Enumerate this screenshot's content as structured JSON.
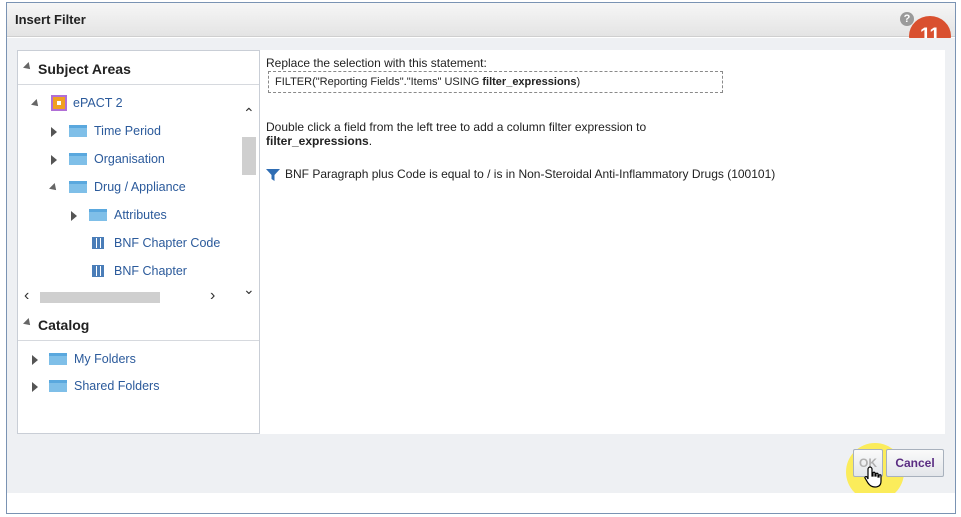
{
  "dialog": {
    "title": "Insert Filter",
    "help_symbol": "?",
    "step_badge": "11"
  },
  "subject_areas": {
    "header": "Subject Areas",
    "root": "ePACT 2",
    "items": [
      {
        "label": "Time Period",
        "icon": "folder-icon"
      },
      {
        "label": "Organisation",
        "icon": "folder-icon"
      },
      {
        "label": "Drug / Appliance",
        "icon": "folder-icon"
      },
      {
        "label": "Attributes",
        "icon": "folder-icon"
      },
      {
        "label": "BNF Chapter Code",
        "icon": "column-icon"
      },
      {
        "label": "BNF Chapter",
        "icon": "column-icon"
      }
    ]
  },
  "catalog": {
    "header": "Catalog",
    "items": [
      {
        "label": "My Folders",
        "icon": "folder-icon"
      },
      {
        "label": "Shared Folders",
        "icon": "folder-icon"
      }
    ]
  },
  "main": {
    "replace_instruction": "Replace the selection with this statement:",
    "statement_prefix": "FILTER(\"Reporting Fields\".\"Items\" USING ",
    "statement_bold": "filter_expressions",
    "statement_suffix": ")",
    "double_click_line1": "Double click a field from the left tree to add a column filter expression to",
    "double_click_bold": "filter_expressions",
    "double_click_suffix": ".",
    "filter_expression": "BNF Paragraph plus Code is equal to / is in  Non-Steroidal Anti-Inflammatory Drugs (100101)"
  },
  "buttons": {
    "ok": "OK",
    "cancel": "Cancel"
  },
  "colors": {
    "badge": "#d9502f",
    "link": "#2b5a9b",
    "cancel_text": "#5a2d82",
    "highlight": "#ffeb28"
  }
}
